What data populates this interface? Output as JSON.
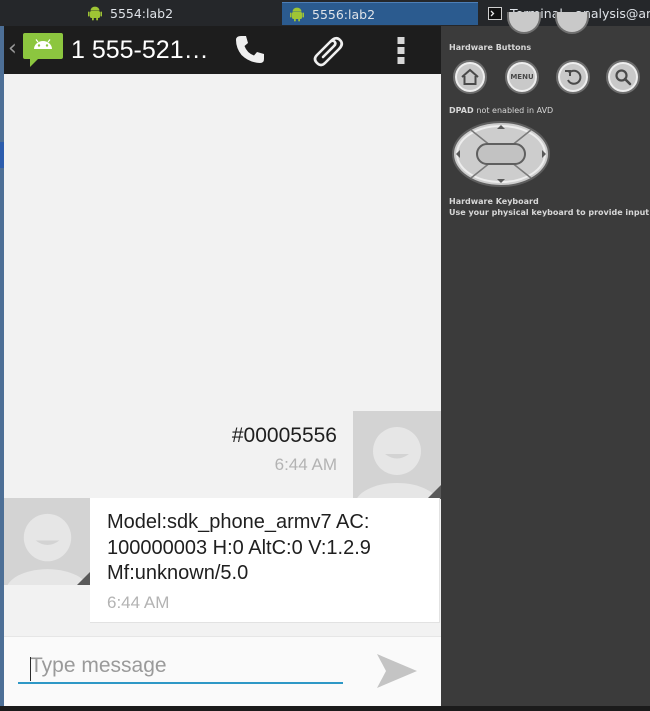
{
  "taskbar": {
    "tabs": [
      {
        "label": "5554:lab2",
        "active": false
      },
      {
        "label": "5556:lab2",
        "active": true
      },
      {
        "label": "Terminal - analysis@ana",
        "active": false
      }
    ]
  },
  "phone": {
    "action_bar": {
      "title": "1 555-521…",
      "app_icon": "messaging-icon",
      "actions": [
        "phone-icon",
        "paperclip-icon",
        "overflow-menu-icon"
      ]
    },
    "messages": [
      {
        "direction": "outgoing",
        "text": "#00005556",
        "time": "6:44 AM"
      },
      {
        "direction": "incoming",
        "text": "Model:sdk_phone_armv7 AC:\n100000003 H:0 AltC:0 V:1.2.9\nMf:unknown/5.0",
        "time": "6:44 AM"
      }
    ],
    "compose": {
      "placeholder": "Type message",
      "value": ""
    }
  },
  "panel": {
    "hardware_buttons_label": "Hardware Buttons",
    "buttons": [
      "home-icon",
      "MENU",
      "back-icon",
      "search-icon"
    ],
    "dpad_label": "DPAD",
    "dpad_note": "not enabled in AVD",
    "keyboard_label": "Hardware Keyboard",
    "keyboard_note": "Use your physical keyboard to provide input"
  },
  "colors": {
    "action_bar": "#1d1d1d",
    "conversation_bg": "#f2f2f2",
    "compose_underline": "#2e98c6",
    "taskbar_active": "#2b5b8f",
    "android_green": "#9fc534"
  }
}
